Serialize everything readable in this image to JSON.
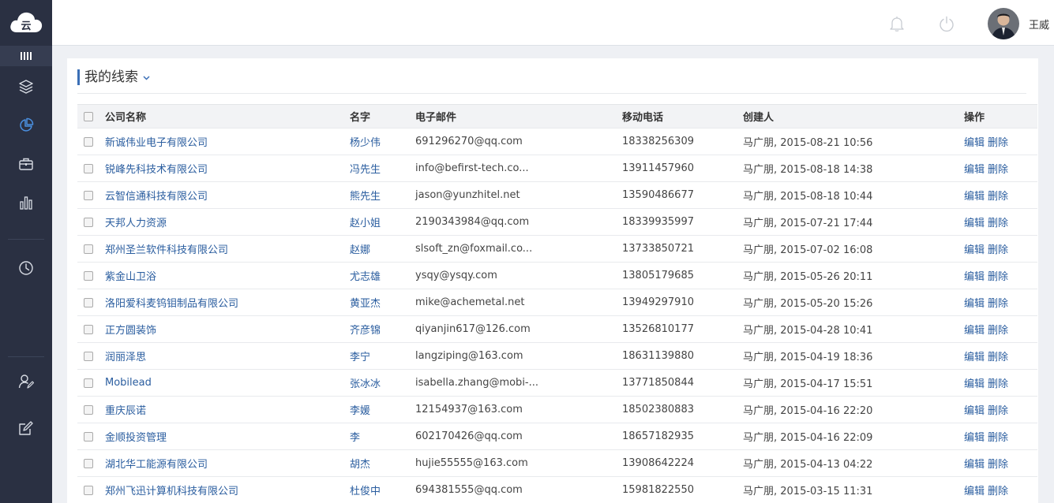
{
  "header": {
    "user_name": "王威",
    "notification_icon": "bell-icon",
    "power_icon": "power-icon"
  },
  "sidebar": {
    "logo_text": "云",
    "items": [
      "layers-icon",
      "pie-chart-icon",
      "briefcase-icon",
      "bar-chart-icon",
      "clock-icon",
      "user-edit-icon",
      "edit-icon"
    ],
    "active_item": "pie-chart-icon"
  },
  "panel": {
    "title": "我的线索"
  },
  "table": {
    "headers": {
      "company": "公司名称",
      "name": "名字",
      "email": "电子邮件",
      "mobile": "移动电话",
      "creator": "创建人",
      "actions": "操作"
    },
    "edit_label": "编辑",
    "delete_label": "删除",
    "rows": [
      {
        "company": "新诚伟业电子有限公司",
        "name": "杨少伟",
        "email": "691296270@qq.com",
        "mobile": "18338256309",
        "creator": "马广朋, 2015-08-21 10:56"
      },
      {
        "company": "锐峰先科技术有限公司",
        "name": "冯先生",
        "email": "info@befirst-tech.co...",
        "mobile": "13911457960",
        "creator": "马广朋, 2015-08-18 14:38"
      },
      {
        "company": "云智信通科技有限公司",
        "name": "熊先生",
        "email": "jason@yunzhitel.net",
        "mobile": "13590486677",
        "creator": "马广朋, 2015-08-18 10:44"
      },
      {
        "company": "天邦人力资源",
        "name": "赵小姐",
        "email": "2190343984@qq.com",
        "mobile": "18339935997",
        "creator": "马广朋, 2015-07-21 17:44"
      },
      {
        "company": "郑州圣兰软件科技有限公司",
        "name": "赵娜",
        "email": "slsoft_zn@foxmail.co...",
        "mobile": "13733850721",
        "creator": "马广朋, 2015-07-02 16:08"
      },
      {
        "company": "紫金山卫浴",
        "name": "尤志雄",
        "email": "ysqy@ysqy.com",
        "mobile": "13805179685",
        "creator": "马广朋, 2015-05-26 20:11"
      },
      {
        "company": "洛阳爱科麦钨钼制品有限公司",
        "name": "黄亚杰",
        "email": "mike@achemetal.net",
        "mobile": "13949297910",
        "creator": "马广朋, 2015-05-20 15:26"
      },
      {
        "company": "正方圆装饰",
        "name": "齐彦锦",
        "email": "qiyanjin617@126.com",
        "mobile": "13526810177",
        "creator": "马广朋, 2015-04-28 10:41"
      },
      {
        "company": "润丽泽思",
        "name": "李宁",
        "email": "langziping@163.com",
        "mobile": "18631139880",
        "creator": "马广朋, 2015-04-19 18:36"
      },
      {
        "company": "Mobilead",
        "name": "张冰冰",
        "email": "isabella.zhang@mobi-...",
        "mobile": "13771850844",
        "creator": "马广朋, 2015-04-17 15:51"
      },
      {
        "company": "重庆辰诺",
        "name": "李媛",
        "email": "12154937@163.com",
        "mobile": "18502380883",
        "creator": "马广朋, 2015-04-16 22:20"
      },
      {
        "company": "金顺投资管理",
        "name": "李",
        "email": "602170426@qq.com",
        "mobile": "18657182935",
        "creator": "马广朋, 2015-04-16 22:09"
      },
      {
        "company": "湖北华工能源有限公司",
        "name": "胡杰",
        "email": "hujie55555@163.com",
        "mobile": "13908642224",
        "creator": "马广朋, 2015-04-13 04:22"
      },
      {
        "company": "郑州飞迅计算机科技有限公司",
        "name": "杜俊中",
        "email": "694381555@qq.com",
        "mobile": "15981822550",
        "creator": "马广朋, 2015-03-15 11:31"
      }
    ]
  },
  "colors": {
    "sidebar_bg": "#2a3042",
    "accent": "#3b6fb6",
    "link": "#2a5d9f",
    "active_icon": "#4a8fe0"
  }
}
